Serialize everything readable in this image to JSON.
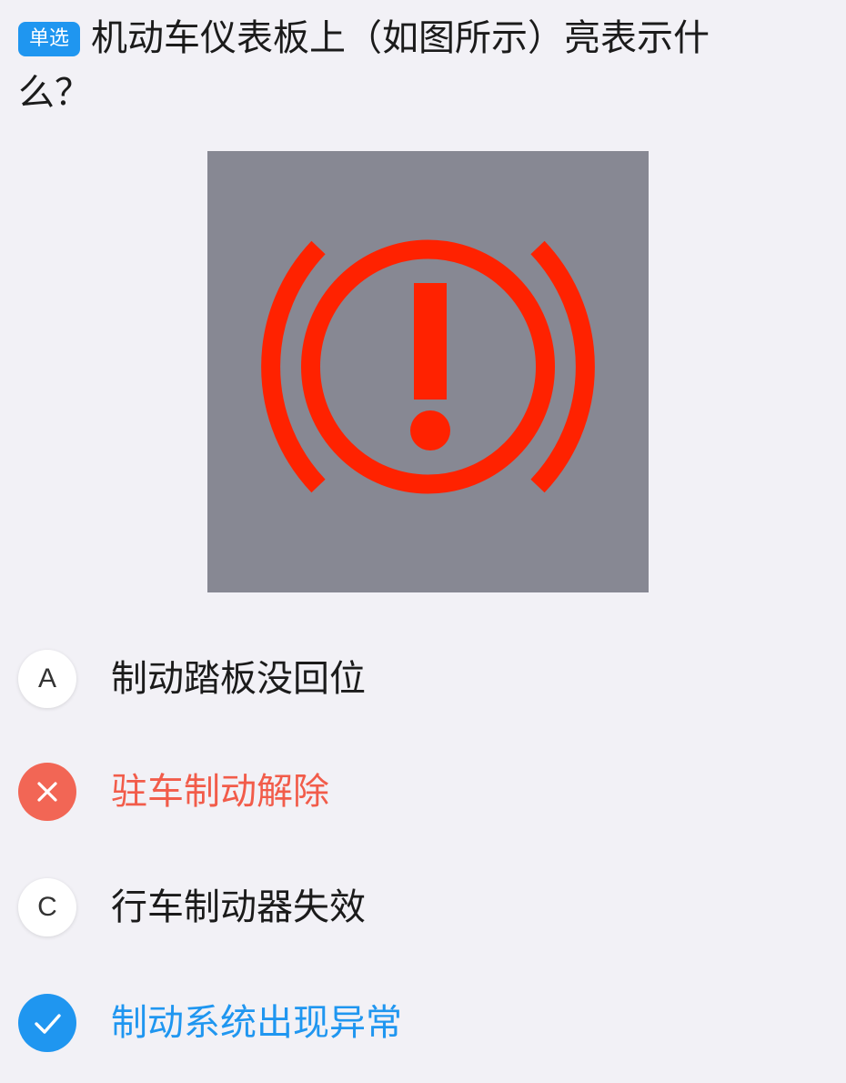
{
  "question": {
    "badge": "单选",
    "text": "机动车仪表板上（如图所示）亮表示什么？"
  },
  "figure": {
    "icon": "brake-warning-icon",
    "background_color": "#878893",
    "symbol_color": "#ff2200"
  },
  "options": [
    {
      "marker": "A",
      "text": "制动踏板没回位",
      "state": "normal"
    },
    {
      "marker": "",
      "marker_icon": "cross-icon",
      "text": "驻车制动解除",
      "state": "wrong"
    },
    {
      "marker": "C",
      "text": "行车制动器失效",
      "state": "normal"
    },
    {
      "marker": "",
      "marker_icon": "check-icon",
      "text": "制动系统出现异常",
      "state": "correct"
    }
  ],
  "colors": {
    "accent": "#1f96f0",
    "wrong": "#f26655",
    "page_background": "#f2f1f6"
  }
}
